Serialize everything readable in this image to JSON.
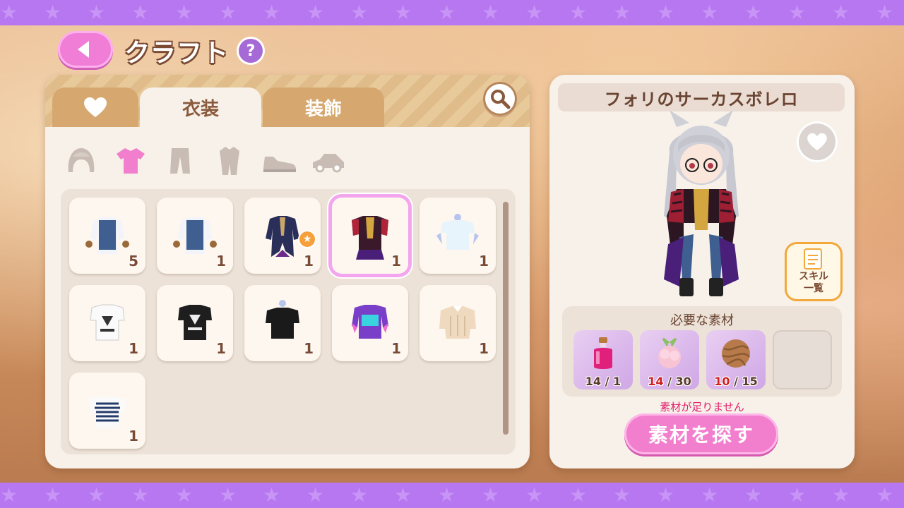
{
  "header": {
    "title": "クラフト",
    "help_label": "?"
  },
  "tabs": [
    {
      "label": "",
      "icon": "heart-icon"
    },
    {
      "label": "衣装"
    },
    {
      "label": "装飾"
    }
  ],
  "categories": [
    "hair-icon",
    "tshirt-icon",
    "pants-icon",
    "set-outfit-icon",
    "shoes-icon",
    "vehicle-icon"
  ],
  "items": [
    {
      "icon": "overalls-top-icon",
      "count": "5"
    },
    {
      "icon": "overalls-top-icon",
      "count": "1"
    },
    {
      "icon": "navy-tailcoat-icon",
      "count": "1",
      "badge": "★"
    },
    {
      "icon": "circus-bolero-icon",
      "count": "1",
      "selected": true
    },
    {
      "icon": "white-tshirt-icon",
      "count": "1"
    },
    {
      "icon": "graphic-tee-white-icon",
      "count": "1"
    },
    {
      "icon": "graphic-tee-black-icon",
      "count": "1"
    },
    {
      "icon": "black-shirt-icon",
      "count": "1"
    },
    {
      "icon": "neon-jacket-icon",
      "count": "1"
    },
    {
      "icon": "knit-sweater-icon",
      "count": "1"
    },
    {
      "icon": "striped-top-icon",
      "count": "1"
    }
  ],
  "detail": {
    "name": "フォリのサーカスボレロ",
    "skill_label": "スキル\n一覧",
    "materials_title": "必要な素材",
    "materials": [
      {
        "icon": "potion-bottle-icon",
        "have": "14",
        "need": "1",
        "short": false
      },
      {
        "icon": "flower-cotton-icon",
        "have": "14",
        "need": "30",
        "short": true
      },
      {
        "icon": "yarn-ball-icon",
        "have": "10",
        "need": "15",
        "short": true
      }
    ],
    "warning": "素材が足りません",
    "find_button": "素材を探す"
  },
  "colors": {
    "accent_pink": "#f27fce",
    "band_purple": "#b677f0",
    "panel": "#f7f1ea",
    "title_brown": "#7a4a33",
    "short_red": "#d02020"
  }
}
